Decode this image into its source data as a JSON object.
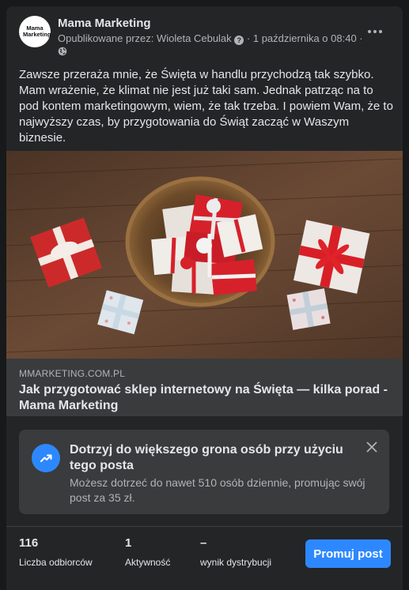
{
  "post": {
    "page_name": "Mama Marketing",
    "avatar_text": "Mama Marketing",
    "meta_prefix": "Opublikowane przez: Wioleta Cebulak",
    "meta_date": "· 1 października o 08:40 ·",
    "text": "Zawsze przeraża mnie, że Święta w handlu przychodzą tak szybko. Mam wrażenie, że klimat nie jest już taki sam. Jednak patrząc na to pod kontem marketingowym, wiem, że tak trzeba. I powiem Wam, że to najwyższy czas, by przygotowania do Świąt zacząć w Waszym biznesie."
  },
  "link": {
    "domain": "MMARKETING.COM.PL",
    "title": "Jak przygotować sklep internetowy na Święta — kilka porad - Mama Marketing"
  },
  "promo": {
    "title": "Dotrzyj do większego grona osób przy użyciu tego posta",
    "description": "Możesz dotrzeć do nawet 510 osób dziennie, promując swój post za 35 zł."
  },
  "stats": [
    {
      "value": "116",
      "label": "Liczba odbiorców"
    },
    {
      "value": "1",
      "label": "Aktywność"
    },
    {
      "value": "–",
      "label": "wynik dystrybucji"
    }
  ],
  "actions": {
    "promote_label": "Promuj post"
  },
  "colors": {
    "background": "#18191a",
    "card": "#242526",
    "accent": "#2d88ff",
    "secondary_text": "#b0b3b8"
  },
  "icons": {
    "more": "more-dots-icon",
    "globe": "globe-icon",
    "help": "question-icon",
    "trend": "trending-up-icon",
    "close": "close-icon"
  }
}
